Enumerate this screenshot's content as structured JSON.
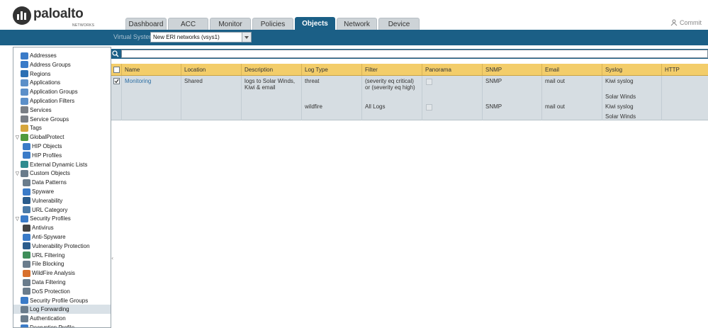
{
  "brand": {
    "name": "paloalto",
    "sub": "NETWORKS"
  },
  "tabs": [
    {
      "label": "Dashboard",
      "w": 58
    },
    {
      "label": "ACC",
      "w": 57
    },
    {
      "label": "Monitor",
      "w": 58
    },
    {
      "label": "Policies",
      "w": 58
    },
    {
      "label": "Objects",
      "w": 57
    },
    {
      "label": "Network",
      "w": 57
    },
    {
      "label": "Device",
      "w": 58
    }
  ],
  "active_tab": "Objects",
  "commit_label": "Commit",
  "vsys": {
    "label": "Virtual System",
    "value": "New ERI networks (vsys1)"
  },
  "sidebar": [
    {
      "label": "Addresses",
      "level": 0,
      "color": "#3a7bc8"
    },
    {
      "label": "Address Groups",
      "level": 0,
      "color": "#3a7bc8"
    },
    {
      "label": "Regions",
      "level": 0,
      "color": "#2b6fb3"
    },
    {
      "label": "Applications",
      "level": 0,
      "color": "#5b8fc9"
    },
    {
      "label": "Application Groups",
      "level": 0,
      "color": "#5b8fc9"
    },
    {
      "label": "Application Filters",
      "level": 0,
      "color": "#5b8fc9"
    },
    {
      "label": "Services",
      "level": 0,
      "color": "#7a7f86"
    },
    {
      "label": "Service Groups",
      "level": 0,
      "color": "#7a7f86"
    },
    {
      "label": "Tags",
      "level": 0,
      "color": "#d6a63c"
    },
    {
      "label": "GlobalProtect",
      "level": 0,
      "color": "#4f9a3c",
      "toggle": "▽"
    },
    {
      "label": "HIP Objects",
      "level": 1,
      "color": "#3a7bc8"
    },
    {
      "label": "HIP Profiles",
      "level": 1,
      "color": "#3a7bc8"
    },
    {
      "label": "External Dynamic Lists",
      "level": 0,
      "color": "#2f8b8f"
    },
    {
      "label": "Custom Objects",
      "level": 0,
      "color": "#6a7c8c",
      "toggle": "▽"
    },
    {
      "label": "Data Patterns",
      "level": 1,
      "color": "#6a7c8c"
    },
    {
      "label": "Spyware",
      "level": 1,
      "color": "#3a7bc8"
    },
    {
      "label": "Vulnerability",
      "level": 1,
      "color": "#2b5c8c"
    },
    {
      "label": "URL Category",
      "level": 1,
      "color": "#4a7aa8"
    },
    {
      "label": "Security Profiles",
      "level": 0,
      "color": "#3a7bc8",
      "toggle": "▽"
    },
    {
      "label": "Antivirus",
      "level": 1,
      "color": "#444"
    },
    {
      "label": "Anti-Spyware",
      "level": 1,
      "color": "#3a7bc8"
    },
    {
      "label": "Vulnerability Protection",
      "level": 1,
      "color": "#2b5c8c"
    },
    {
      "label": "URL Filtering",
      "level": 1,
      "color": "#3f8e5a"
    },
    {
      "label": "File Blocking",
      "level": 1,
      "color": "#6a7c8c"
    },
    {
      "label": "WildFire Analysis",
      "level": 1,
      "color": "#d8702c"
    },
    {
      "label": "Data Filtering",
      "level": 1,
      "color": "#6a7c8c"
    },
    {
      "label": "DoS Protection",
      "level": 1,
      "color": "#6a7c8c"
    },
    {
      "label": "Security Profile Groups",
      "level": 0,
      "color": "#3a7bc8"
    },
    {
      "label": "Log Forwarding",
      "level": 0,
      "color": "#6a7c8c",
      "selected": true
    },
    {
      "label": "Authentication",
      "level": 0,
      "color": "#6a7c8c"
    },
    {
      "label": "Decryption Profile",
      "level": 0,
      "color": "#3a7bc8"
    }
  ],
  "columns": [
    "",
    "Name",
    "Location",
    "Description",
    "Log Type",
    "Filter",
    "Panorama",
    "SNMP",
    "Email",
    "Syslog",
    "HTTP"
  ],
  "row": {
    "name": "Monitoring",
    "location": "Shared",
    "description": "logs to Solar Winds, Kiwi & email",
    "entries": [
      {
        "log_type": "threat",
        "filter": "(severity eq critical) or (severity eq high)",
        "snmp": "SNMP",
        "email": "mail out",
        "syslog": [
          "Kiwi syslog",
          "Solar Winds"
        ]
      },
      {
        "log_type": "wildfire",
        "filter": "All Logs",
        "snmp": "SNMP",
        "email": "mail out",
        "syslog": [
          "Kiwi syslog",
          "Solar Winds"
        ]
      }
    ]
  }
}
